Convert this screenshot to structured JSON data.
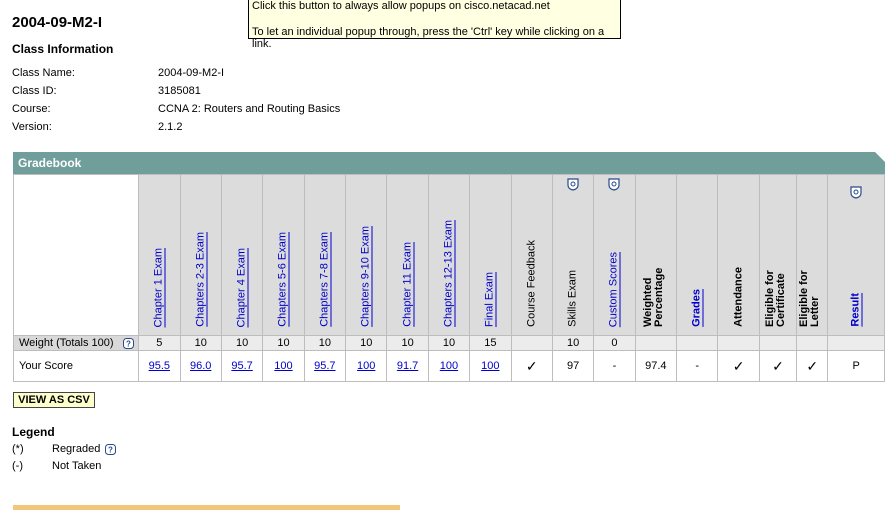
{
  "page_title": "2004-09-M2-I",
  "class_info": {
    "title": "Class Information",
    "rows": [
      {
        "label": "Class Name:",
        "value": "2004-09-M2-I"
      },
      {
        "label": "Class ID:",
        "value": "3185081"
      },
      {
        "label": "Course:",
        "value": "CCNA 2: Routers and Routing Basics"
      },
      {
        "label": "Version:",
        "value": "2.1.2"
      }
    ]
  },
  "popup_tip": {
    "line1": "Click this button to always allow popups on cisco.netacad.net",
    "line2": "To let an individual popup through, press the 'Ctrl' key while clicking on a link."
  },
  "gradebook": {
    "title": "Gradebook",
    "weight_label": "Weight (Totals 100)",
    "score_label": "Your Score",
    "columns": [
      {
        "label": "Chapter 1 Exam",
        "weight": "5",
        "score": "95.5"
      },
      {
        "label": "Chapters 2-3 Exam",
        "weight": "10",
        "score": "96.0"
      },
      {
        "label": "Chapter 4 Exam",
        "weight": "10",
        "score": "95.7"
      },
      {
        "label": "Chapters 5-6 Exam",
        "weight": "10",
        "score": "100"
      },
      {
        "label": "Chapters 7-8 Exam",
        "weight": "10",
        "score": "95.7"
      },
      {
        "label": "Chapters 9-10 Exam",
        "weight": "10",
        "score": "100"
      },
      {
        "label": "Chapter 11 Exam",
        "weight": "10",
        "score": "91.7"
      },
      {
        "label": "Chapters 12-13 Exam",
        "weight": "10",
        "score": "100"
      },
      {
        "label": "Final Exam",
        "weight": "15",
        "score": "100"
      },
      {
        "label": "Course Feedback",
        "weight": "",
        "score": "✓"
      },
      {
        "label": "Skills Exam",
        "weight": "10",
        "score": "97"
      },
      {
        "label": "Custom Scores",
        "weight": "0",
        "score": "-"
      },
      {
        "label": "Weighted Percentage",
        "weight": "",
        "score": "97.4"
      },
      {
        "label": "Grades",
        "weight": "",
        "score": "-"
      },
      {
        "label": "Attendance",
        "weight": "",
        "score": "✓"
      },
      {
        "label": "Eligible for Certificate",
        "weight": "",
        "score": "✓"
      },
      {
        "label": "Eligible for Letter",
        "weight": "",
        "score": "✓"
      },
      {
        "label": "Result",
        "weight": "",
        "score": "P"
      }
    ]
  },
  "csv_button": "VIEW AS CSV",
  "legend": {
    "title": "Legend",
    "items": [
      {
        "symbol": "(*)",
        "text": "Regraded"
      },
      {
        "symbol": "(-)",
        "text": "Not Taken"
      }
    ]
  },
  "colors": {
    "gradebook_header": "#6f9e9b",
    "header_cell": "#dcdcdc",
    "link": "#0000cc",
    "csv_button_bg": "#ffffcc",
    "bottom_bar": "#f3c779"
  }
}
